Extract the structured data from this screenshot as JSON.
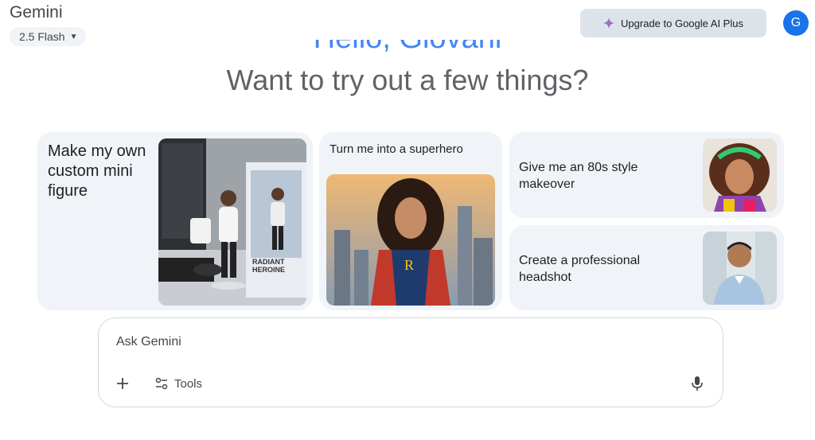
{
  "header": {
    "app_name": "Gemini",
    "model_label": "2.5 Flash",
    "upgrade_label": "Upgrade to Google AI Plus",
    "avatar_initial": "G"
  },
  "greeting": "Hello, Giovani",
  "subtitle": "Want to try out a few things?",
  "cards": [
    {
      "label": "Make my own custom mini figure",
      "image": "mini-figure-packaging-photo"
    },
    {
      "label": "Turn me into a superhero",
      "image": "superhero-portrait"
    },
    {
      "label": "Give me an 80s style makeover",
      "image": "80s-makeover-portrait"
    },
    {
      "label": "Create a professional headshot",
      "image": "professional-headshot-portrait"
    }
  ],
  "input": {
    "placeholder": "Ask Gemini",
    "tools_label": "Tools"
  },
  "colors": {
    "accent": "#4285f4",
    "card_bg": "#f0f4f9",
    "upgrade_bg": "#dde3ea"
  }
}
